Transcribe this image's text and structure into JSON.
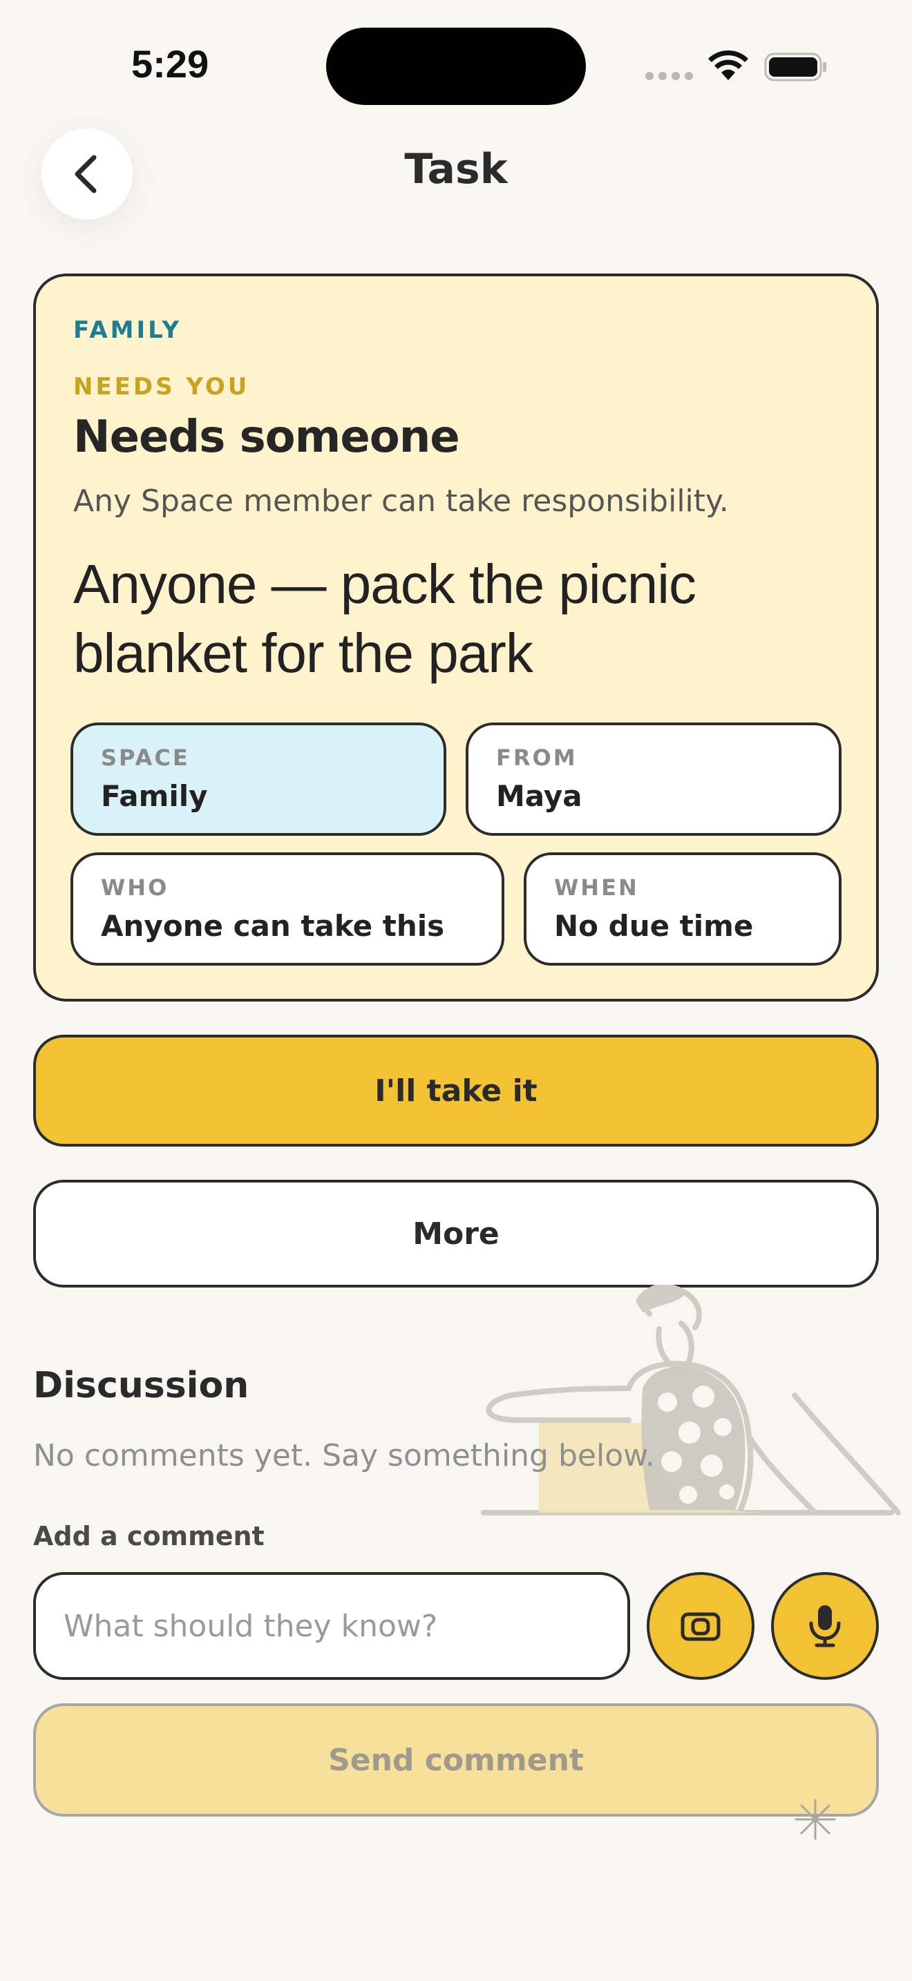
{
  "status_bar": {
    "time": "5:29"
  },
  "header": {
    "back_icon": "chevron-left-icon",
    "title": "Task"
  },
  "task": {
    "space_kicker": "FAMILY",
    "status_kicker": "NEEDS YOU",
    "status_heading": "Needs someone",
    "status_description": "Any Space member can take responsibility.",
    "title": "Anyone — pack the picnic blanket for the park",
    "details": {
      "space": {
        "label": "SPACE",
        "value": "Family"
      },
      "from": {
        "label": "FROM",
        "value": "Maya"
      },
      "who": {
        "label": "WHO",
        "value": "Anyone can take this"
      },
      "when": {
        "label": "WHEN",
        "value": "No due time"
      }
    }
  },
  "actions": {
    "take_label": "I'll take it",
    "more_label": "More"
  },
  "discussion": {
    "heading": "Discussion",
    "empty_text": "No comments yet. Say something below.",
    "add_label": "Add a comment",
    "input_placeholder": "What should they know?",
    "input_value": "",
    "camera_icon": "camera-icon",
    "mic_icon": "microphone-icon",
    "send_label": "Send comment"
  },
  "colors": {
    "background": "#f8f6f1",
    "card": "#fef3cc",
    "accent_yellow": "#f2c232",
    "space_teal": "#1c7d96",
    "needs_gold": "#c9a21e",
    "space_chip": "#d8f2f8"
  }
}
